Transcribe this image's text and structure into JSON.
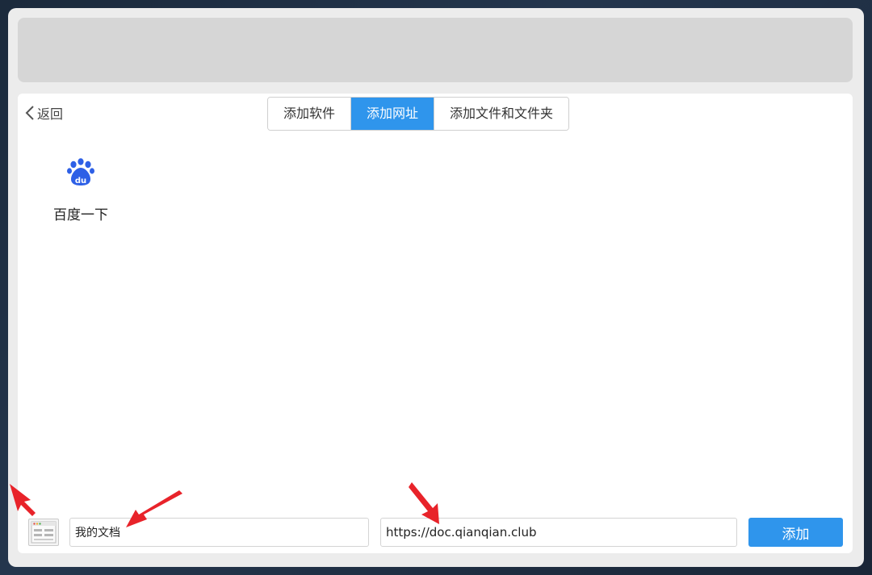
{
  "header": {
    "back_label": "返回"
  },
  "tabs": [
    {
      "label": "添加软件",
      "active": false
    },
    {
      "label": "添加网址",
      "active": true
    },
    {
      "label": "添加文件和文件夹",
      "active": false
    }
  ],
  "items": [
    {
      "label": "百度一下",
      "icon": "baidu-paw-icon"
    }
  ],
  "form": {
    "name_value": "我的文档",
    "url_value": "https://doc.qianqian.club",
    "add_label": "添加"
  },
  "colors": {
    "accent": "#2f95ec",
    "annotation": "#e8232a",
    "baidu_blue": "#2e60e6"
  }
}
